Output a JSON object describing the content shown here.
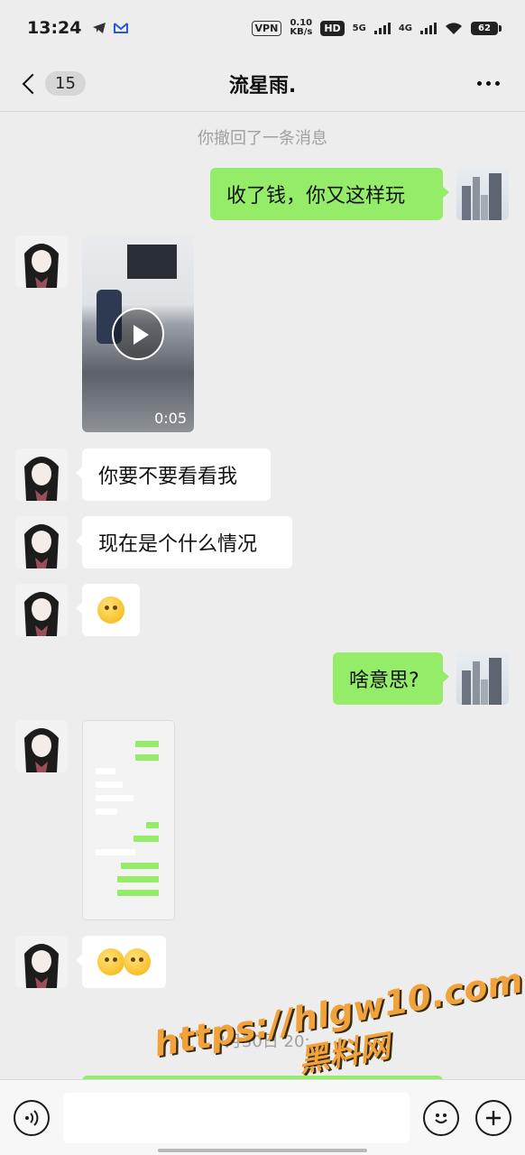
{
  "status_bar": {
    "time": "13:24",
    "vpn": "VPN",
    "speed_value": "0.10",
    "speed_unit": "KB/s",
    "hd": "HD",
    "net_1": "5G",
    "net_2": "4G",
    "battery": "62"
  },
  "nav": {
    "title": "流星雨.",
    "unread_count": "15"
  },
  "messages": {
    "recalled": "你撤回了一条消息",
    "m1": "收了钱，你又这样玩",
    "video_duration": "0:05",
    "m2": "你要不要看看我",
    "m3": "现在是个什么情况",
    "m4": "啥意思?",
    "date_stamp": "3月30日 20:"
  },
  "watermark": {
    "line1": "https://hlgw10.com",
    "line2": "黑料网"
  },
  "colors": {
    "outgoing_bubble": "#95ec69",
    "incoming_bubble": "#ffffff",
    "background": "#ededed"
  },
  "icons": {
    "voice": "voice-icon",
    "emoji": "emoji-icon",
    "plus": "plus-icon"
  }
}
